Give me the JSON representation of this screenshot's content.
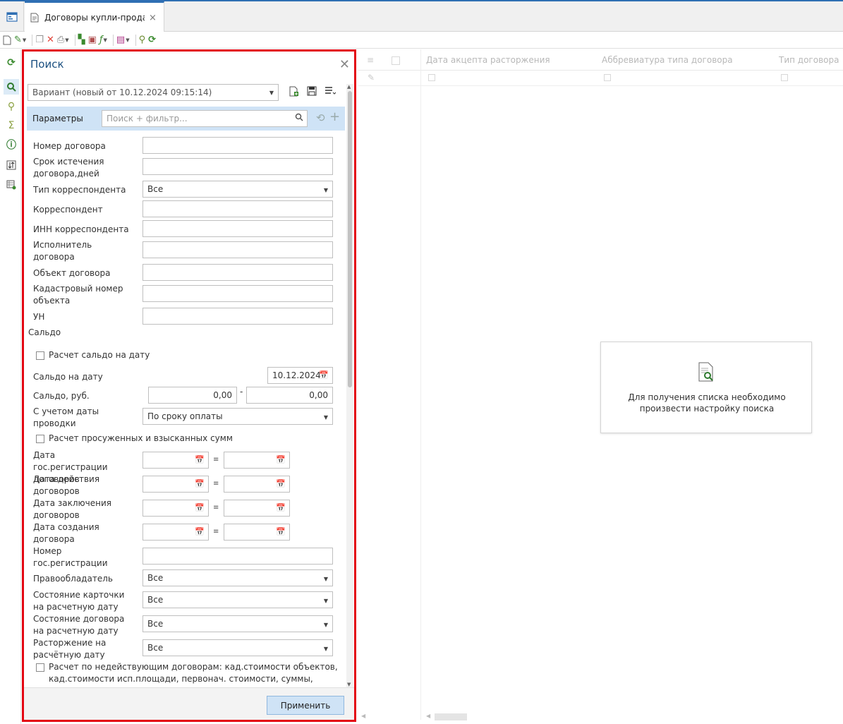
{
  "tabs": {
    "document_tab_label": "Договоры купли-прода...",
    "close_glyph": "×"
  },
  "toolbar": {
    "icons": [
      "new-document-icon",
      "edit-icon",
      "copy-icon",
      "delete-icon",
      "print-icon",
      "export-icon",
      "import-icon",
      "formula-icon",
      "report-icon",
      "filter-icon",
      "refresh-icon"
    ]
  },
  "leftbar": {
    "icons": [
      "refresh-icon",
      "search-icon",
      "filter-icon",
      "sum-icon",
      "info-icon",
      "sort-icon",
      "settings-grid-icon"
    ]
  },
  "search_panel": {
    "title": "Поиск",
    "variant_value": "Вариант (новый от 10.12.2024 09:15:14)",
    "params_label": "Параметры",
    "params_search_placeholder": "Поиск + фильтр...",
    "fields": {
      "contract_number": "Номер договора",
      "expiry_days": "Срок истечения договора,дней",
      "correspondent_type": "Тип корреспондента",
      "correspondent_type_value": "Все",
      "correspondent": "Корреспондент",
      "inn": "ИНН корреспондента",
      "executor": "Исполнитель договора",
      "object": "Объект договора",
      "cadastral": "Кадастровый номер объекта",
      "un": "УН"
    },
    "saldo": {
      "section": "Сальдо",
      "calc_on_date": "Расчет сальдо на дату",
      "saldo_date_label": "Сальдо на дату",
      "saldo_date_value": "10.12.2024",
      "saldo_rub_label": "Сальдо, руб.",
      "saldo_from": "0,00",
      "dash": "-",
      "saldo_to": "0,00",
      "posting_date_label": "С учетом даты проводки",
      "posting_date_value": "По сроку оплаты",
      "overdue_label": "Расчет просуженных и взысканных сумм"
    },
    "date_ranges": {
      "reg_date": "Дата гос.регистрации договоров",
      "action_date": "Дата действия договоров",
      "conclusion_date": "Дата заключения договоров",
      "creation_date": "Дата создания договора"
    },
    "reg_number_label": "Номер гос.регистрации",
    "holder_label": "Правообладатель",
    "holder_value": "Все",
    "card_state_label": "Состояние карточки на расчетную дату",
    "card_state_value": "Все",
    "contract_state_label": "Состояние договора на расчетную дату",
    "contract_state_value": "Все",
    "termination_label": "Расторжение на расчётную дату",
    "termination_value": "Все",
    "inactive_calc_label": "Расчет по недействующим договорам: кад.стоимости объектов, кад.стоимости исп.площади, первонач. стоимости, суммы, площади",
    "apply_button": "Применить"
  },
  "grid": {
    "columns": [
      "Дата акцепта расторжения",
      "Аббревиатура типа договора",
      "Тип договора"
    ]
  },
  "message": {
    "text": "Для получения списка необходимо произвести настройку поиска"
  }
}
